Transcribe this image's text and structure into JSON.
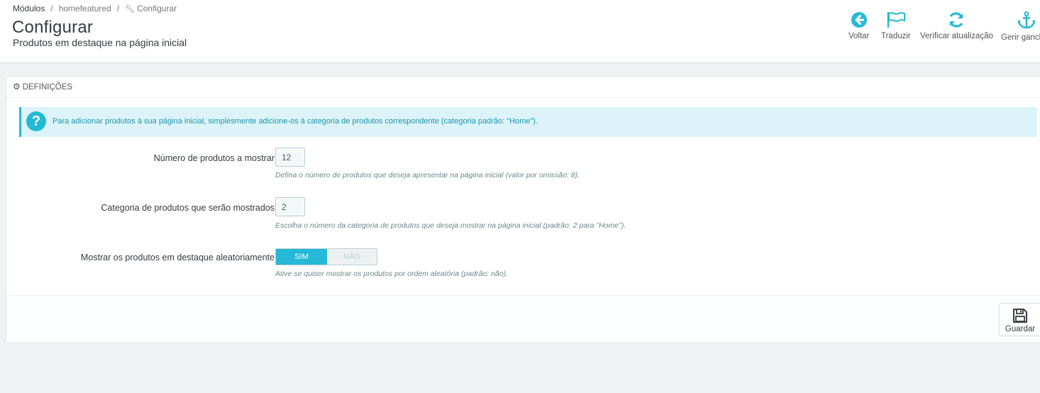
{
  "breadcrumb": {
    "item1": "Módulos",
    "item2": "homefeatured",
    "item3": "Configurar",
    "separator": "/"
  },
  "header": {
    "title": "Configurar",
    "subtitle": "Produtos em destaque na página inicial"
  },
  "toolbar": {
    "back_label": "Voltar",
    "translate_label": "Traduzir",
    "check_update_label": "Verificar atualização",
    "manage_hooks_label": "Gerir ganchos"
  },
  "panel": {
    "heading": "DEFINIÇÕES",
    "alert_text": "Para adicionar produtos à sua página inicial, simplesmente adicione-os à categoria de produtos correspondente (categoria padrão: \"Home\").",
    "fields": {
      "num_products": {
        "label": "Número de produtos a mostrar",
        "value": "12",
        "help": "Defina o número de produtos que deseja apresentar na página inicial (valor por omissão: 8)."
      },
      "category": {
        "label": "Categoria de produtos que serão mostrados",
        "value": "2",
        "help": "Escolha o número da categoria de produtos que deseja mostrar na página inicial (padrão: 2 para \"Home\")."
      },
      "random": {
        "label": "Mostrar os produtos em destaque aleatoriamente",
        "on_label": "SIM",
        "off_label": "NÃO",
        "selected": "SIM",
        "help": "Ative se quiser mostrar os produtos por ordem aleatória (padrão: não)."
      }
    },
    "save_label": "Guardar"
  },
  "colors": {
    "accent": "#25b9d7",
    "alert_bg": "#dcf4f9",
    "page_bg": "#eff1f2"
  },
  "icons": {
    "back": "arrow-circle-left-icon",
    "translate": "flag-icon",
    "update": "refresh-icon",
    "hooks": "anchor-icon",
    "save": "floppy-disk-icon",
    "help": "question-circle-icon",
    "settings": "cogs-icon",
    "configure": "wrench-icon"
  }
}
